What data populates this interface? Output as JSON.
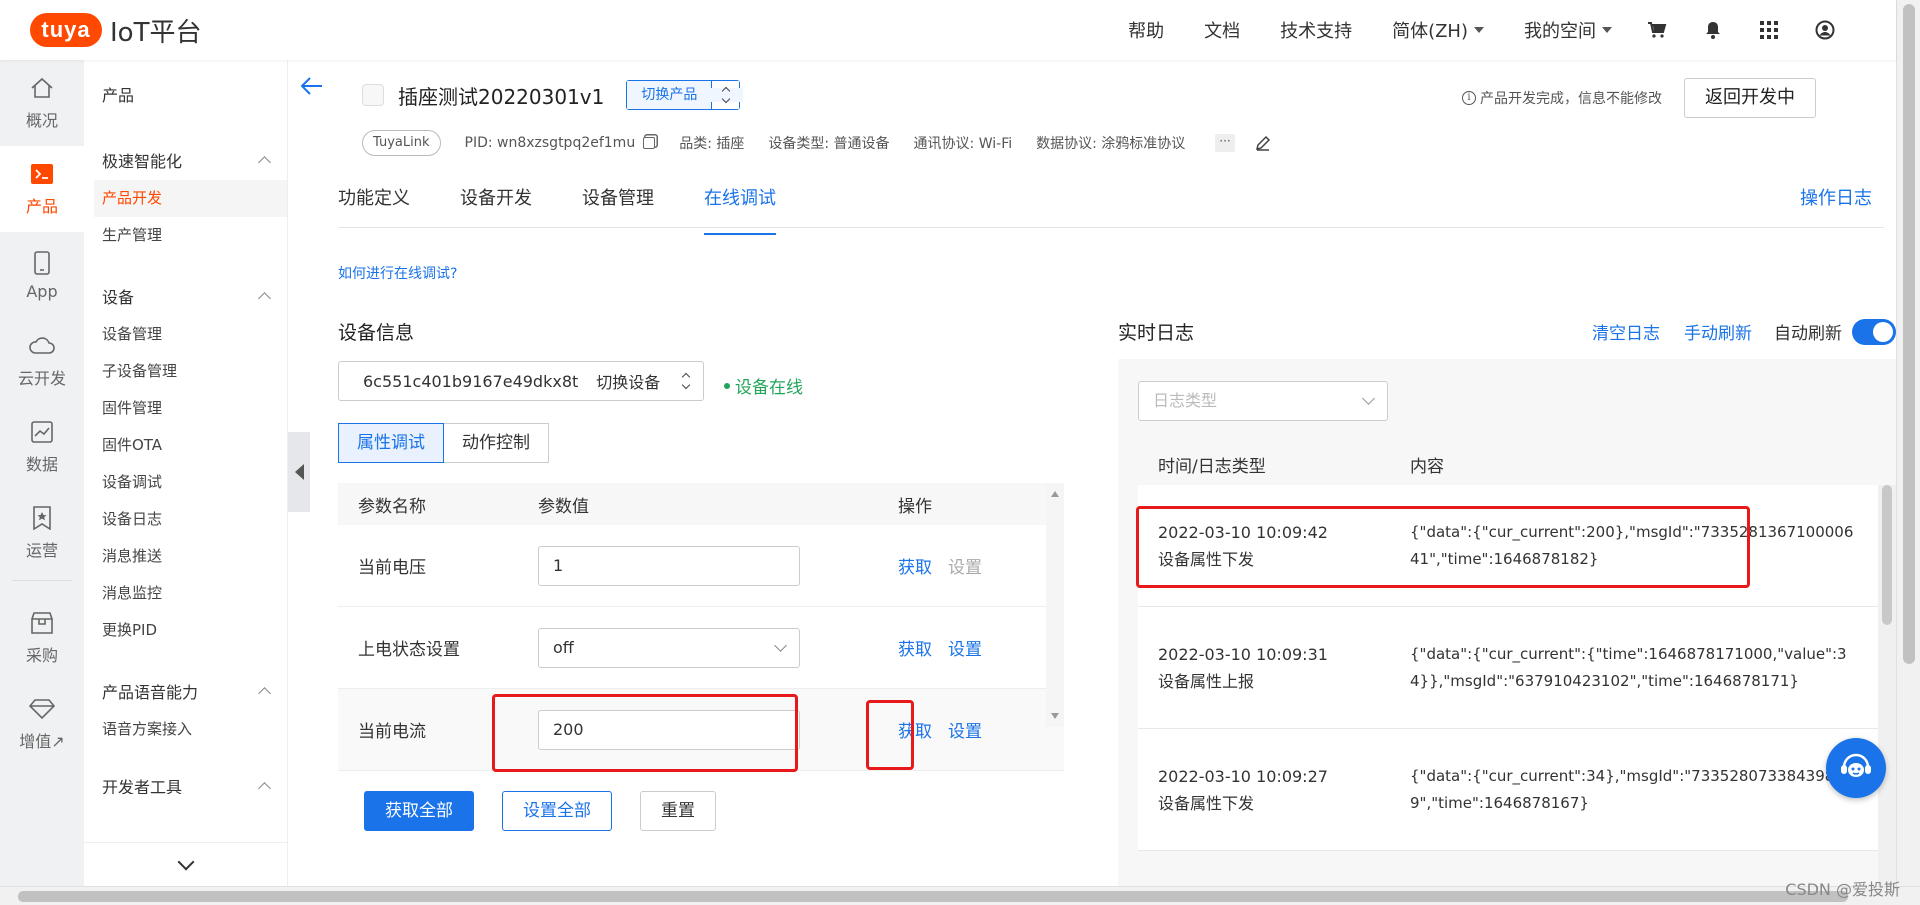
{
  "brand": {
    "logo": "tuya",
    "title": "IoT平台",
    "logo_color": "#ff4800"
  },
  "topnav": {
    "help": "帮助",
    "docs": "文档",
    "support": "技术支持",
    "lang": "简体(ZH)",
    "space": "我的空间",
    "icons": [
      "cart-icon",
      "bell-icon",
      "apps-grid-icon",
      "user-icon"
    ]
  },
  "rail": [
    {
      "label": "概况",
      "icon": "home-icon"
    },
    {
      "label": "产品",
      "icon": "terminal-icon",
      "active": true
    },
    {
      "label": "App",
      "icon": "phone-icon"
    },
    {
      "label": "云开发",
      "icon": "cloud-icon"
    },
    {
      "label": "数据",
      "icon": "chart-icon"
    },
    {
      "label": "运营",
      "icon": "bookmark-icon"
    },
    {
      "label": "采购",
      "icon": "shop-icon"
    },
    {
      "label": "增值↗",
      "icon": "diamond-icon"
    }
  ],
  "sidebar": {
    "title": "产品",
    "group1": "极速智能化",
    "group1_items": [
      "产品开发",
      "生产管理"
    ],
    "group2": "设备",
    "group2_items": [
      "设备管理",
      "子设备管理",
      "固件管理",
      "固件OTA",
      "设备调试",
      "设备日志",
      "消息推送",
      "消息监控",
      "更换PID"
    ],
    "group3": "产品语音能力",
    "group3_items": [
      "语音方案接入"
    ],
    "group4": "开发者工具"
  },
  "product": {
    "name": "插座测试20220301v1",
    "switch_label": "切换产品",
    "notice": "产品开发完成，信息不能修改",
    "back_button": "返回开发中",
    "tag": "TuyaLink",
    "pid": "PID: wn8xzsgtpq2ef1mu",
    "category": "品类: 插座",
    "device_type": "设备类型: 普通设备",
    "comm_protocol": "通讯协议: Wi-Fi",
    "data_protocol": "数据协议: 涂鸦标准协议",
    "more": "···"
  },
  "tabs": [
    "功能定义",
    "设备开发",
    "设备管理",
    "在线调试"
  ],
  "active_tab": "在线调试",
  "op_log": "操作日志",
  "help_link": "如何进行在线调试?",
  "device": {
    "section_title": "设备信息",
    "device_id": "6c551c401b9167e49dkx8t",
    "switch_device": "切换设备",
    "status": "设备在线",
    "seg_props": "属性调试",
    "seg_actions": "动作控制"
  },
  "param_table": {
    "headers": [
      "参数名称",
      "参数值",
      "操作"
    ],
    "rows": [
      {
        "name": "当前电压",
        "value": "1",
        "get": "获取",
        "set": "设置",
        "set_disabled": true
      },
      {
        "name": "上电状态设置",
        "value": "off",
        "get": "获取",
        "set": "设置",
        "dropdown": true
      },
      {
        "name": "当前电流",
        "value": "200",
        "get": "获取",
        "set": "设置"
      }
    ]
  },
  "buttons": {
    "get_all": "获取全部",
    "set_all": "设置全部",
    "reset": "重置"
  },
  "log": {
    "title": "实时日志",
    "clear": "清空日志",
    "refresh": "手动刷新",
    "auto": "自动刷新",
    "filter_placeholder": "日志类型",
    "headers": [
      "时间/日志类型",
      "内容"
    ],
    "rows": [
      {
        "time": "2022-03-10 10:09:42",
        "type": "设备属性下发",
        "content": "{\"data\":{\"cur_current\":200},\"msgId\":\"733528136710000641\",\"time\":1646878182}"
      },
      {
        "time": "2022-03-10 10:09:31",
        "type": "设备属性上报",
        "content": "{\"data\":{\"cur_current\":{\"time\":1646878171000,\"value\":34}},\"msgId\":\"637910423102\",\"time\":1646878171}"
      },
      {
        "time": "2022-03-10 10:09:27",
        "type": "设备属性下发",
        "content": "{\"data\":{\"cur_current\":34},\"msgId\":\"733528073384398849\",\"time\":1646878167}"
      }
    ]
  },
  "watermark": "CSDN @爱投斯",
  "colors": {
    "accent": "#1a73e8",
    "brand": "#ff4800",
    "online": "#22a55b",
    "highlight": "#e8191a"
  }
}
